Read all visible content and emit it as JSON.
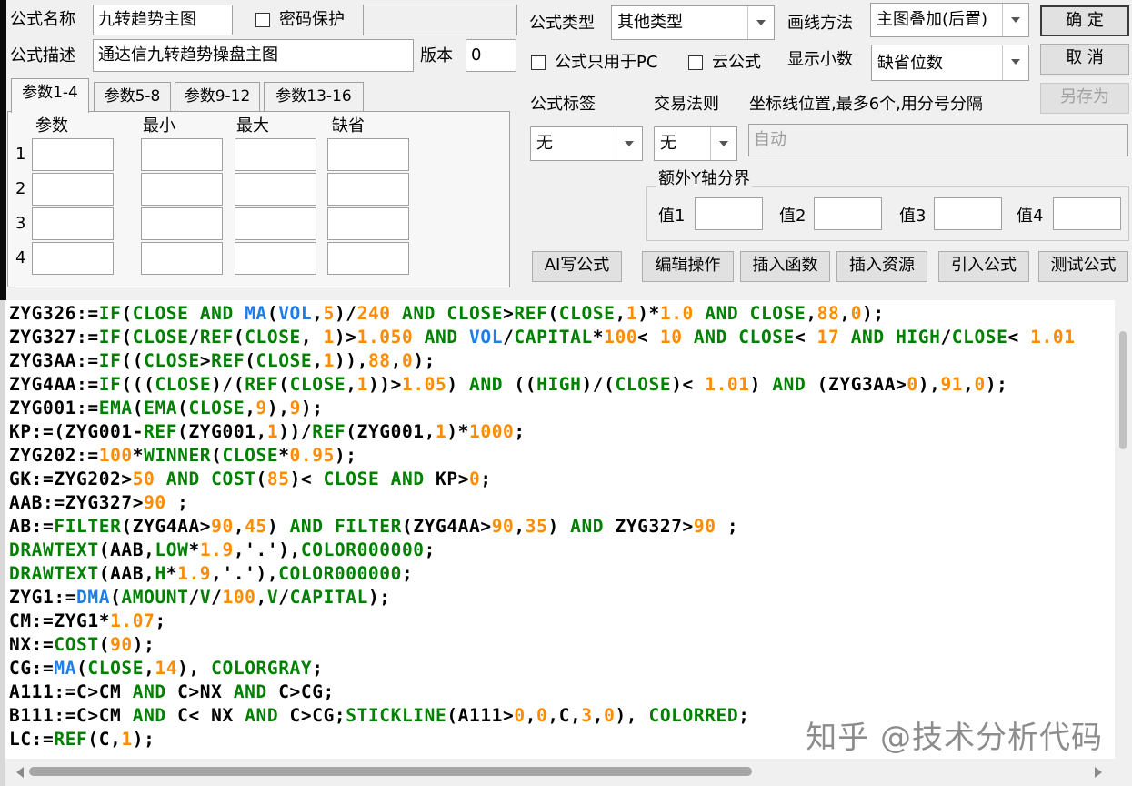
{
  "form": {
    "name_label": "公式名称",
    "name_value": "九转趋势主图",
    "password_label": "密码保护",
    "desc_label": "公式描述",
    "desc_value": "通达信九转趋势操盘主图",
    "version_label": "版本",
    "version_value": "0"
  },
  "settings": {
    "type_label": "公式类型",
    "type_value": "其他类型",
    "draw_label": "画线方法",
    "draw_value": "主图叠加(后置)",
    "pc_only_label": "公式只用于PC",
    "cloud_label": "云公式",
    "decimal_label": "显示小数",
    "decimal_value": "缺省位数",
    "tag_label": "公式标签",
    "tag_value": "无",
    "rule_label": "交易法则",
    "rule_value": "无",
    "coord_label": "坐标线位置,最多6个,用分号分隔",
    "coord_value": "自动",
    "yaxis_group": "额外Y轴分界",
    "val1": "值1",
    "val2": "值2",
    "val3": "值3",
    "val4": "值4"
  },
  "buttons": {
    "ok": "确 定",
    "cancel": "取 消",
    "save_as": "另存为",
    "ai": "AI写公式",
    "edit": "编辑操作",
    "insert_func": "插入函数",
    "insert_res": "插入资源",
    "import": "引入公式",
    "test": "测试公式"
  },
  "params": {
    "tabs": [
      "参数1-4",
      "参数5-8",
      "参数9-12",
      "参数13-16"
    ],
    "headers": [
      "参数",
      "最小",
      "最大",
      "缺省"
    ],
    "rows": [
      "1",
      "2",
      "3",
      "4"
    ]
  },
  "code_lines": [
    [
      [
        "t",
        "ZYG326:="
      ],
      [
        "s",
        "IF"
      ],
      [
        "t",
        "("
      ],
      [
        "s",
        "CLOSE"
      ],
      [
        "t",
        " "
      ],
      [
        "s",
        "AND"
      ],
      [
        "t",
        " "
      ],
      [
        "f",
        "MA"
      ],
      [
        "t",
        "("
      ],
      [
        "f",
        "VOL"
      ],
      [
        "t",
        ","
      ],
      [
        "n",
        "5"
      ],
      [
        "t",
        ")/"
      ],
      [
        "n",
        "240"
      ],
      [
        "t",
        " "
      ],
      [
        "s",
        "AND"
      ],
      [
        "t",
        " "
      ],
      [
        "s",
        "CLOSE"
      ],
      [
        "t",
        ">"
      ],
      [
        "s",
        "REF"
      ],
      [
        "t",
        "("
      ],
      [
        "s",
        "CLOSE"
      ],
      [
        "t",
        ","
      ],
      [
        "n",
        "1"
      ],
      [
        "t",
        ")*"
      ],
      [
        "n",
        "1.0"
      ],
      [
        "t",
        " "
      ],
      [
        "s",
        "AND"
      ],
      [
        "t",
        " "
      ],
      [
        "s",
        "CLOSE"
      ],
      [
        "t",
        ","
      ],
      [
        "n",
        "88"
      ],
      [
        "t",
        ","
      ],
      [
        "n",
        "0"
      ],
      [
        "t",
        ");"
      ]
    ],
    [
      [
        "t",
        "ZYG327:="
      ],
      [
        "s",
        "IF"
      ],
      [
        "t",
        "("
      ],
      [
        "s",
        "CLOSE"
      ],
      [
        "t",
        "/"
      ],
      [
        "s",
        "REF"
      ],
      [
        "t",
        "("
      ],
      [
        "s",
        "CLOSE"
      ],
      [
        "t",
        ", "
      ],
      [
        "n",
        "1"
      ],
      [
        "t",
        ")>"
      ],
      [
        "n",
        "1.050"
      ],
      [
        "t",
        " "
      ],
      [
        "s",
        "AND"
      ],
      [
        "t",
        " "
      ],
      [
        "f",
        "VOL"
      ],
      [
        "t",
        "/"
      ],
      [
        "s",
        "CAPITAL"
      ],
      [
        "t",
        "*"
      ],
      [
        "n",
        "100"
      ],
      [
        "t",
        "< "
      ],
      [
        "n",
        "10"
      ],
      [
        "t",
        " "
      ],
      [
        "s",
        "AND"
      ],
      [
        "t",
        " "
      ],
      [
        "s",
        "CLOSE"
      ],
      [
        "t",
        "< "
      ],
      [
        "n",
        "17"
      ],
      [
        "t",
        " "
      ],
      [
        "s",
        "AND"
      ],
      [
        "t",
        " "
      ],
      [
        "s",
        "HIGH"
      ],
      [
        "t",
        "/"
      ],
      [
        "s",
        "CLOSE"
      ],
      [
        "t",
        "< "
      ],
      [
        "n",
        "1.01"
      ]
    ],
    [
      [
        "t",
        "ZYG3AA:="
      ],
      [
        "s",
        "IF"
      ],
      [
        "t",
        "(("
      ],
      [
        "s",
        "CLOSE"
      ],
      [
        "t",
        ">"
      ],
      [
        "s",
        "REF"
      ],
      [
        "t",
        "("
      ],
      [
        "s",
        "CLOSE"
      ],
      [
        "t",
        ","
      ],
      [
        "n",
        "1"
      ],
      [
        "t",
        ")),"
      ],
      [
        "n",
        "88"
      ],
      [
        "t",
        ","
      ],
      [
        "n",
        "0"
      ],
      [
        "t",
        ");"
      ]
    ],
    [
      [
        "t",
        "ZYG4AA:="
      ],
      [
        "s",
        "IF"
      ],
      [
        "t",
        "((("
      ],
      [
        "s",
        "CLOSE"
      ],
      [
        "t",
        ")/("
      ],
      [
        "s",
        "REF"
      ],
      [
        "t",
        "("
      ],
      [
        "s",
        "CLOSE"
      ],
      [
        "t",
        ","
      ],
      [
        "n",
        "1"
      ],
      [
        "t",
        "))>"
      ],
      [
        "n",
        "1.05"
      ],
      [
        "t",
        ") "
      ],
      [
        "s",
        "AND"
      ],
      [
        "t",
        " (("
      ],
      [
        "s",
        "HIGH"
      ],
      [
        "t",
        ")/("
      ],
      [
        "s",
        "CLOSE"
      ],
      [
        "t",
        ")< "
      ],
      [
        "n",
        "1.01"
      ],
      [
        "t",
        ") "
      ],
      [
        "s",
        "AND"
      ],
      [
        "t",
        " (ZYG3AA>"
      ],
      [
        "n",
        "0"
      ],
      [
        "t",
        "),"
      ],
      [
        "n",
        "91"
      ],
      [
        "t",
        ","
      ],
      [
        "n",
        "0"
      ],
      [
        "t",
        ");"
      ]
    ],
    [
      [
        "t",
        "ZYG001:="
      ],
      [
        "s",
        "EMA"
      ],
      [
        "t",
        "("
      ],
      [
        "s",
        "EMA"
      ],
      [
        "t",
        "("
      ],
      [
        "s",
        "CLOSE"
      ],
      [
        "t",
        ","
      ],
      [
        "n",
        "9"
      ],
      [
        "t",
        "),"
      ],
      [
        "n",
        "9"
      ],
      [
        "t",
        ");"
      ]
    ],
    [
      [
        "t",
        "KP:=(ZYG001-"
      ],
      [
        "s",
        "REF"
      ],
      [
        "t",
        "(ZYG001,"
      ],
      [
        "n",
        "1"
      ],
      [
        "t",
        "))/"
      ],
      [
        "s",
        "REF"
      ],
      [
        "t",
        "(ZYG001,"
      ],
      [
        "n",
        "1"
      ],
      [
        "t",
        ")*"
      ],
      [
        "n",
        "1000"
      ],
      [
        "t",
        ";"
      ]
    ],
    [
      [
        "t",
        "ZYG202:="
      ],
      [
        "n",
        "100"
      ],
      [
        "t",
        "*"
      ],
      [
        "s",
        "WINNER"
      ],
      [
        "t",
        "("
      ],
      [
        "s",
        "CLOSE"
      ],
      [
        "t",
        "*"
      ],
      [
        "n",
        "0.95"
      ],
      [
        "t",
        ");"
      ]
    ],
    [
      [
        "t",
        "GK:=ZYG202>"
      ],
      [
        "n",
        "50"
      ],
      [
        "t",
        " "
      ],
      [
        "s",
        "AND"
      ],
      [
        "t",
        " "
      ],
      [
        "s",
        "COST"
      ],
      [
        "t",
        "("
      ],
      [
        "n",
        "85"
      ],
      [
        "t",
        ")< "
      ],
      [
        "s",
        "CLOSE"
      ],
      [
        "t",
        " "
      ],
      [
        "s",
        "AND"
      ],
      [
        "t",
        " KP>"
      ],
      [
        "n",
        "0"
      ],
      [
        "t",
        ";"
      ]
    ],
    [
      [
        "t",
        "AAB:=ZYG327>"
      ],
      [
        "n",
        "90"
      ],
      [
        "t",
        " ;"
      ]
    ],
    [
      [
        "t",
        "AB:="
      ],
      [
        "s",
        "FILTER"
      ],
      [
        "t",
        "(ZYG4AA>"
      ],
      [
        "n",
        "90"
      ],
      [
        "t",
        ","
      ],
      [
        "n",
        "45"
      ],
      [
        "t",
        ") "
      ],
      [
        "s",
        "AND"
      ],
      [
        "t",
        " "
      ],
      [
        "s",
        "FILTER"
      ],
      [
        "t",
        "(ZYG4AA>"
      ],
      [
        "n",
        "90"
      ],
      [
        "t",
        ","
      ],
      [
        "n",
        "35"
      ],
      [
        "t",
        ") "
      ],
      [
        "s",
        "AND"
      ],
      [
        "t",
        " ZYG327>"
      ],
      [
        "n",
        "90"
      ],
      [
        "t",
        " ;"
      ]
    ],
    [
      [
        "s",
        "DRAWTEXT"
      ],
      [
        "t",
        "(AAB,"
      ],
      [
        "s",
        "LOW"
      ],
      [
        "t",
        "*"
      ],
      [
        "n",
        "1.9"
      ],
      [
        "t",
        ",'.'),"
      ],
      [
        "s",
        "COLOR000000"
      ],
      [
        "t",
        ";"
      ]
    ],
    [
      [
        "s",
        "DRAWTEXT"
      ],
      [
        "t",
        "(AAB,"
      ],
      [
        "s",
        "H"
      ],
      [
        "t",
        "*"
      ],
      [
        "n",
        "1.9"
      ],
      [
        "t",
        ",'.'),"
      ],
      [
        "s",
        "COLOR000000"
      ],
      [
        "t",
        ";"
      ]
    ],
    [
      [
        "t",
        "ZYG1:="
      ],
      [
        "f",
        "DMA"
      ],
      [
        "t",
        "("
      ],
      [
        "s",
        "AMOUNT"
      ],
      [
        "t",
        "/"
      ],
      [
        "s",
        "V"
      ],
      [
        "t",
        "/"
      ],
      [
        "n",
        "100"
      ],
      [
        "t",
        ","
      ],
      [
        "s",
        "V"
      ],
      [
        "t",
        "/"
      ],
      [
        "s",
        "CAPITAL"
      ],
      [
        "t",
        ");"
      ]
    ],
    [
      [
        "t",
        "CM:=ZYG1*"
      ],
      [
        "n",
        "1.07"
      ],
      [
        "t",
        ";"
      ]
    ],
    [
      [
        "t",
        "NX:="
      ],
      [
        "s",
        "COST"
      ],
      [
        "t",
        "("
      ],
      [
        "n",
        "90"
      ],
      [
        "t",
        ");"
      ]
    ],
    [
      [
        "t",
        "CG:="
      ],
      [
        "f",
        "MA"
      ],
      [
        "t",
        "("
      ],
      [
        "s",
        "CLOSE"
      ],
      [
        "t",
        ","
      ],
      [
        "n",
        "14"
      ],
      [
        "t",
        "), "
      ],
      [
        "s",
        "COLORGRAY"
      ],
      [
        "t",
        ";"
      ]
    ],
    [
      [
        "t",
        "A111:=C>CM "
      ],
      [
        "s",
        "AND"
      ],
      [
        "t",
        " C>NX "
      ],
      [
        "s",
        "AND"
      ],
      [
        "t",
        " C>CG;"
      ]
    ],
    [
      [
        "t",
        "B111:=C>CM "
      ],
      [
        "s",
        "AND"
      ],
      [
        "t",
        " C< NX "
      ],
      [
        "s",
        "AND"
      ],
      [
        "t",
        " C>CG;"
      ],
      [
        "s",
        "STICKLINE"
      ],
      [
        "t",
        "(A111>"
      ],
      [
        "n",
        "0"
      ],
      [
        "t",
        ","
      ],
      [
        "n",
        "0"
      ],
      [
        "t",
        ",C,"
      ],
      [
        "n",
        "3"
      ],
      [
        "t",
        ","
      ],
      [
        "n",
        "0"
      ],
      [
        "t",
        "), "
      ],
      [
        "s",
        "COLORRED"
      ],
      [
        "t",
        ";"
      ]
    ],
    [
      [
        "t",
        "LC:="
      ],
      [
        "s",
        "REF"
      ],
      [
        "t",
        "(C,"
      ],
      [
        "n",
        "1"
      ],
      [
        "t",
        ");"
      ]
    ]
  ],
  "watermark": "知乎 @技术分析代码"
}
